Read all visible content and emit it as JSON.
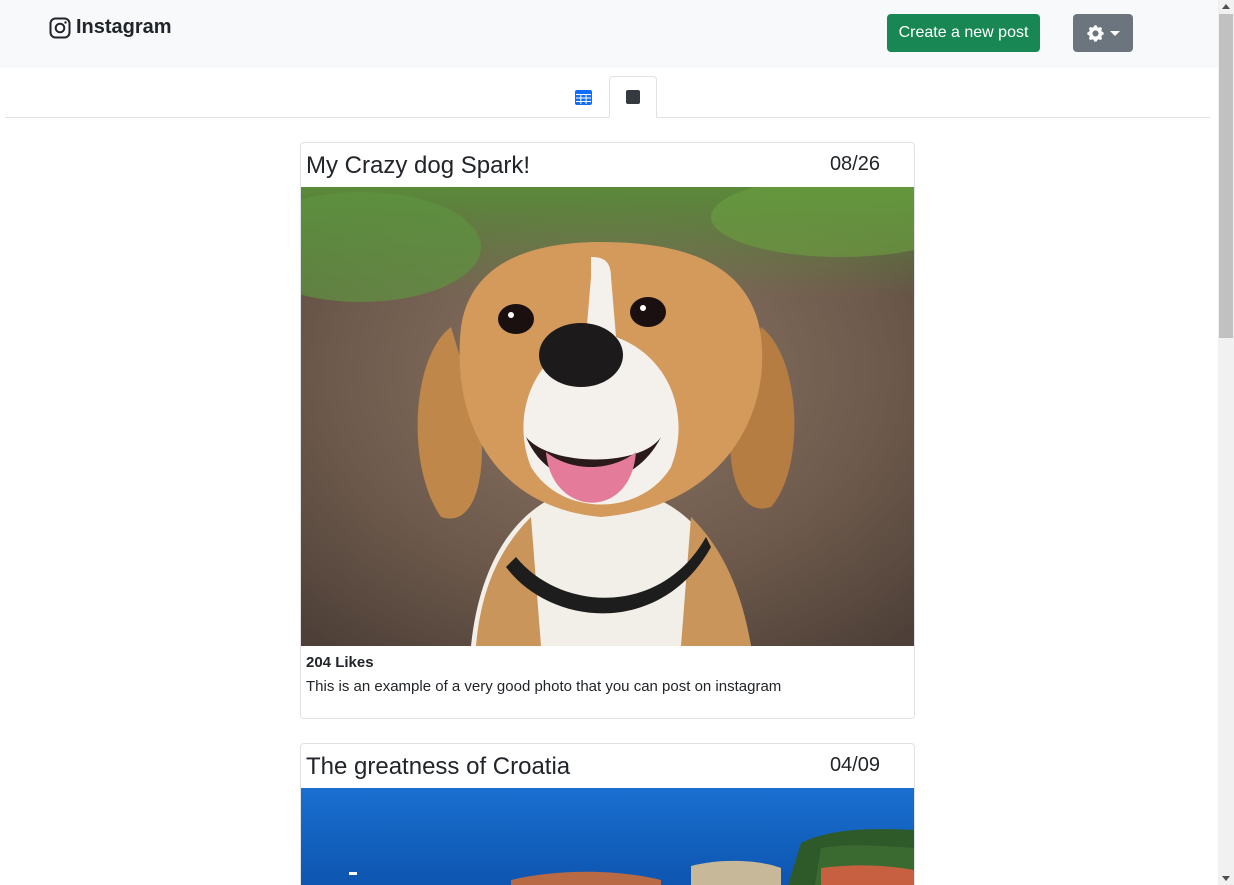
{
  "navbar": {
    "brand": "Instagram",
    "create_button": "Create a new post",
    "settings_icon": "gear-icon"
  },
  "tabs": [
    {
      "icon": "grid-icon",
      "active": false
    },
    {
      "icon": "square-icon",
      "active": true
    }
  ],
  "posts": [
    {
      "title": "My Crazy dog Spark!",
      "date": "08/26",
      "image": "beagle-photo",
      "likes": "204 Likes",
      "description": "This is an example of a very good photo that you can post on instagram"
    },
    {
      "title": "The greatness of Croatia",
      "date": "04/09",
      "image": "croatia-coast-photo"
    }
  ],
  "colors": {
    "primary": "#0d6efd",
    "success": "#198754",
    "secondary": "#6c757d",
    "navbar_bg": "#f8f9fa"
  }
}
